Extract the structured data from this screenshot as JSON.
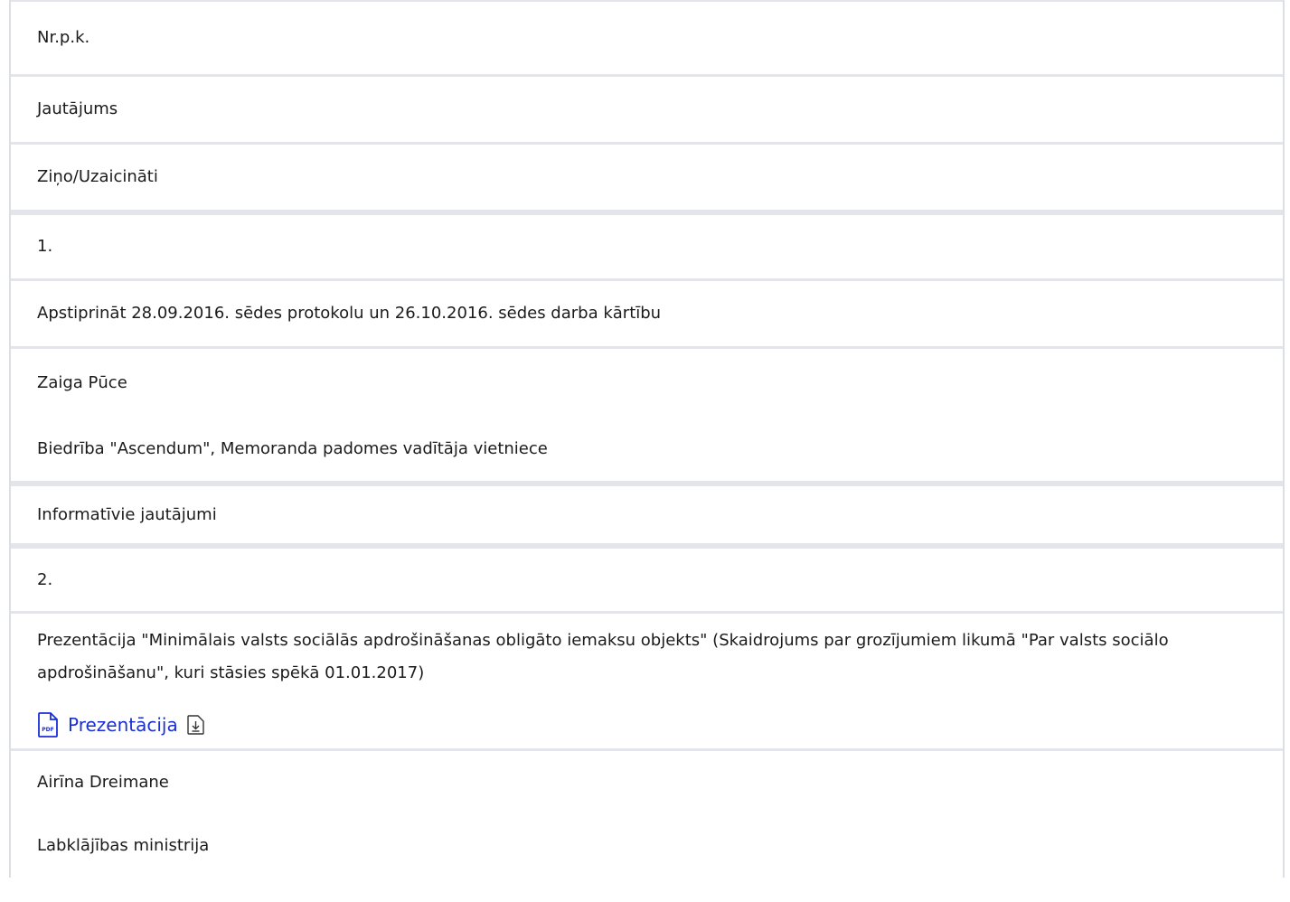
{
  "header": {
    "nr": "Nr.p.k.",
    "question": "Jautājums",
    "speakers": "Ziņo/Uzaicināti"
  },
  "items": [
    {
      "nr": "1.",
      "question": "Apstiprināt 28.09.2016. sēdes protokolu un 26.10.2016. sēdes darba kārtību",
      "speaker_name": "Zaiga Pūce",
      "speaker_org": "Biedrība \"Ascendum\", Memoranda padomes vadītāja vietniece"
    },
    {
      "section": "Informatīvie jautājumi"
    },
    {
      "nr": "2.",
      "question": "Prezentācija \"Minimālais valsts sociālās apdrošināšanas obligāto iemaksu objekts\" (Skaidrojums par grozījumiem likumā \"Par valsts sociālo apdrošināšanu\", kuri stāsies spēkā 01.01.2017)",
      "attachment": {
        "label": "Prezentācija",
        "icon": "pdf-file-icon",
        "download_icon": "download-icon"
      },
      "speaker_name": "Airīna Dreimane",
      "speaker_org": "Labklājības ministrija"
    }
  ],
  "colors": {
    "link": "#1a2fd6",
    "border": "#dcdfe4",
    "text": "#1b1b1b"
  }
}
